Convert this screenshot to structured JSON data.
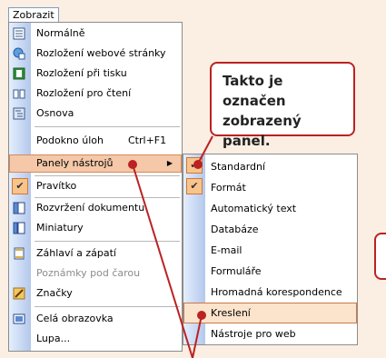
{
  "menubar": {
    "menu_label": "Zobrazit"
  },
  "menu": {
    "items": [
      {
        "label": "Normálně",
        "icon": "normal-view-icon"
      },
      {
        "label": "Rozložení webové stránky",
        "icon": "web-layout-icon"
      },
      {
        "label": "Rozložení při tisku",
        "icon": "print-layout-icon"
      },
      {
        "label": "Rozložení pro čtení",
        "icon": "reading-layout-icon"
      },
      {
        "label": "Osnova",
        "icon": "outline-view-icon"
      },
      {
        "label": "Podokno úloh",
        "shortcut": "Ctrl+F1"
      },
      {
        "label": "Panely nástrojů",
        "has_submenu": true
      },
      {
        "label": "Pravítko",
        "checked": true
      },
      {
        "label": "Rozvržení dokumentu",
        "icon": "document-map-icon"
      },
      {
        "label": "Miniatury",
        "icon": "thumbnails-icon"
      },
      {
        "label": "Záhlaví a zápatí",
        "icon": "header-footer-icon"
      },
      {
        "label": "Poznámky pod čarou",
        "disabled": true
      },
      {
        "label": "Značky",
        "icon": "markup-icon"
      },
      {
        "label": "Celá obrazovka",
        "icon": "fullscreen-icon"
      },
      {
        "label": "Lupa..."
      }
    ]
  },
  "submenu": {
    "items": [
      {
        "label": "Standardní",
        "checked": true
      },
      {
        "label": "Formát",
        "checked": true
      },
      {
        "label": "Automatický text"
      },
      {
        "label": "Databáze"
      },
      {
        "label": "E-mail"
      },
      {
        "label": "Formuláře"
      },
      {
        "label": "Hromadná korespondence"
      },
      {
        "label": "Kreslení"
      },
      {
        "label": "Nástroje pro web"
      }
    ]
  },
  "callout": {
    "line1": "Takto je označen",
    "line2": "zobrazený panel."
  },
  "colors": {
    "accent": "#bb2222",
    "highlight": "#f4c8a8",
    "gutter": "#b4c8ec"
  }
}
